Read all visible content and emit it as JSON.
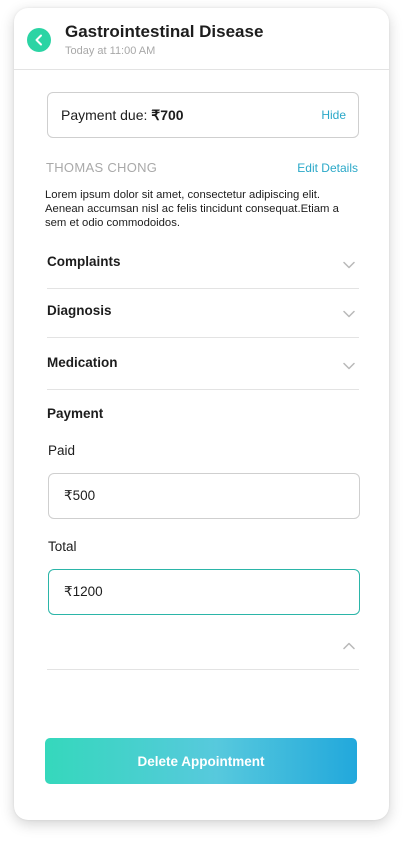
{
  "header": {
    "title": "Gastrointestinal Disease",
    "subtitle": "Today at 11:00 AM"
  },
  "payment_due": {
    "label": "Payment due: ",
    "amount": "₹700",
    "hide_label": "Hide"
  },
  "patient": {
    "name": "THOMAS CHONG",
    "edit_label": "Edit Details",
    "description": "Lorem ipsum dolor sit amet, consectetur adipiscing elit. Aenean accumsan nisl ac felis tincidunt consequat.Etiam a sem et odio commodoidos."
  },
  "sections": {
    "complaints": "Complaints",
    "diagnosis": "Diagnosis",
    "medication": "Medication"
  },
  "payment": {
    "heading": "Payment",
    "paid_label": "Paid",
    "paid_value": "₹500",
    "total_label": "Total",
    "total_value": "₹1200"
  },
  "actions": {
    "delete_label": "Delete Appointment"
  },
  "colors": {
    "accent_green": "#2bd4a4",
    "link_blue": "#2aa8c8",
    "gradient_start": "#35d8bc",
    "gradient_end": "#22a8dc"
  },
  "icons": {
    "back": "chevron-left-icon",
    "expand": "chevron-down-icon",
    "collapse": "chevron-up-icon"
  }
}
